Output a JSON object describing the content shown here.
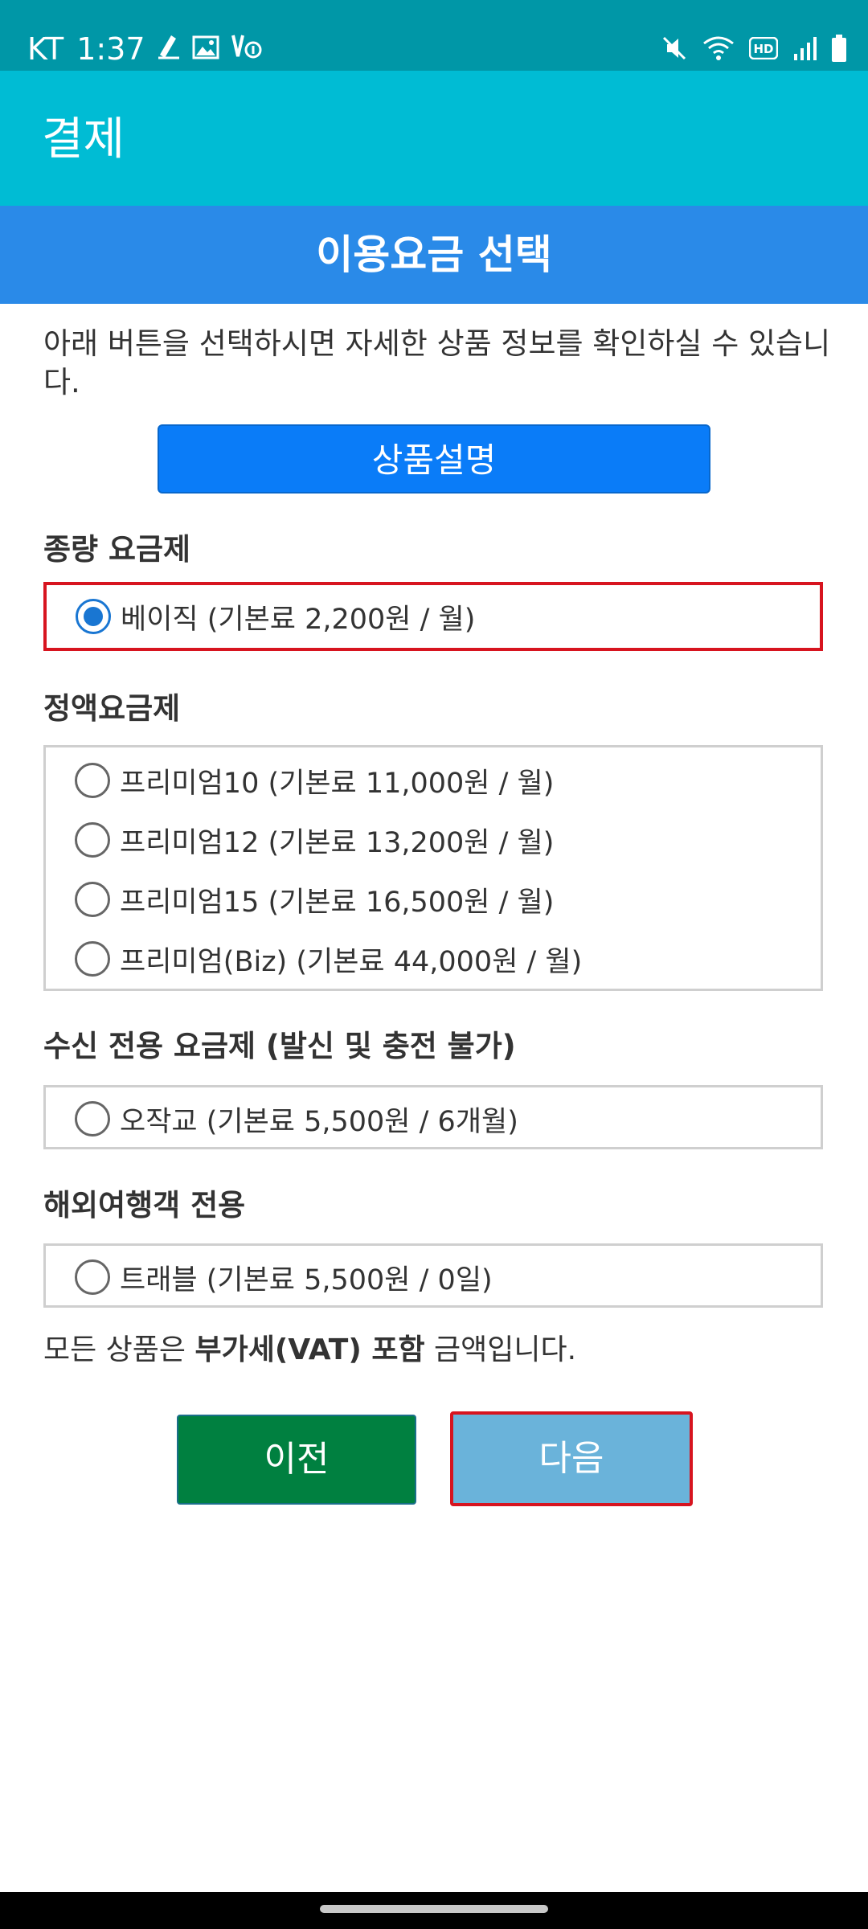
{
  "status_bar": {
    "carrier": "KT",
    "time": "1:37",
    "icons_left": [
      "signature-icon",
      "image-icon",
      "phone-update-icon"
    ],
    "icons_right": [
      "mute-icon",
      "wifi-icon",
      "hd-icon",
      "signal-icon",
      "battery-icon"
    ]
  },
  "app_bar": {
    "title": "결제"
  },
  "section": {
    "title": "이용요금 선택"
  },
  "intro_text": "아래 버튼을 선택하시면 자세한 상품 정보를 확인하실 수 있습니다.",
  "description_button": "상품설명",
  "groups": [
    {
      "title": "종량 요금제",
      "options": [
        {
          "label": "베이직 (기본료 2,200원 / 월)",
          "checked": true
        }
      ]
    },
    {
      "title": "정액요금제",
      "options": [
        {
          "label": "프리미엄10 (기본료 11,000원 / 월)",
          "checked": false
        },
        {
          "label": "프리미엄12 (기본료 13,200원 / 월)",
          "checked": false
        },
        {
          "label": "프리미엄15 (기본료 16,500원 / 월)",
          "checked": false
        },
        {
          "label": "프리미엄(Biz) (기본료 44,000원 / 월)",
          "checked": false
        }
      ]
    },
    {
      "title": "수신 전용 요금제 (발신 및 충전 불가)",
      "options": [
        {
          "label": "오작교 (기본료 5,500원 / 6개월)",
          "checked": false
        }
      ]
    },
    {
      "title": "해외여행객 전용",
      "options": [
        {
          "label": "트래블 (기본료 5,500원 / 0일)",
          "checked": false
        }
      ]
    }
  ],
  "vat_note": {
    "prefix": "모든 상품은 ",
    "bold": "부가세(VAT) 포함",
    "suffix": " 금액입니다."
  },
  "buttons": {
    "prev": "이전",
    "next": "다음"
  },
  "colors": {
    "status_bar": "#0097a7",
    "app_bar": "#00bcd4",
    "section_header": "#2a8ae8",
    "description_button": "#0a7cf8",
    "prev_button": "#008040",
    "next_button": "#6ab3da",
    "highlight": "#d7141f",
    "radio_checked": "#1976d2"
  }
}
